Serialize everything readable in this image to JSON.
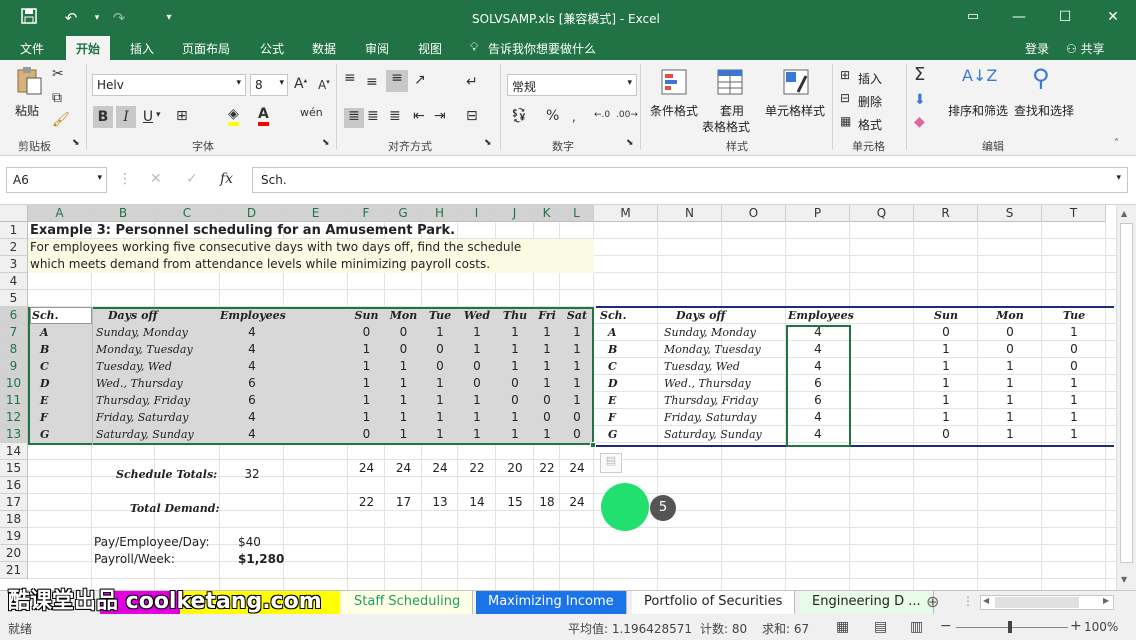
{
  "window": {
    "title": "SOLVSAMP.xls  [兼容模式] - Excel",
    "login_label": "登录",
    "share_label": "共享"
  },
  "menu": {
    "items": [
      "文件",
      "开始",
      "插入",
      "页面布局",
      "公式",
      "数据",
      "审阅",
      "视图"
    ],
    "tell_me": "告诉我你想要做什么"
  },
  "ribbon": {
    "paste_label": "粘贴",
    "font_name": "Helv",
    "font_size": "8",
    "number_format": "常规",
    "bold": "B",
    "italic": "I",
    "underline": "U",
    "conditional_format": "条件格式",
    "table_format_1": "套用",
    "table_format_2": "表格格式",
    "cell_style": "单元格样式",
    "insert": "插入",
    "delete": "删除",
    "format": "格式",
    "sort_filter": "排序和筛选",
    "find_select": "查找和选择",
    "groups": {
      "clipboard": "剪贴板",
      "font": "字体",
      "alignment": "对齐方式",
      "number": "数字",
      "styles": "样式",
      "cells": "单元格",
      "editing": "编辑"
    }
  },
  "formula_bar": {
    "name_box": "A6",
    "fx": "fx",
    "content": "Sch."
  },
  "sheet": {
    "columns": [
      "A",
      "B",
      "C",
      "D",
      "E",
      "F",
      "G",
      "H",
      "I",
      "J",
      "K",
      "L",
      "M",
      "N",
      "O",
      "P",
      "Q",
      "R",
      "S",
      "T"
    ],
    "rows": [
      "1",
      "2",
      "3",
      "4",
      "5",
      "6",
      "7",
      "8",
      "9",
      "10",
      "11",
      "12",
      "13",
      "14",
      "15",
      "16",
      "17",
      "18",
      "19",
      "20",
      "21"
    ],
    "title": "Example 3:  Personnel scheduling for an Amusement Park.",
    "desc1": "For employees working five consecutive days with two days off, find the schedule",
    "desc2": "which meets demand from attendance levels while minimizing payroll costs.",
    "left_headers": {
      "sch": "Sch.",
      "days_off": "Days off",
      "employees": "Employees",
      "days": [
        "Sun",
        "Mon",
        "Tue",
        "Wed",
        "Thu",
        "Fri",
        "Sat"
      ]
    },
    "right_headers": {
      "sch": "Sch.",
      "days_off": "Days off",
      "employees": "Employees",
      "days": [
        "Sun",
        "Mon",
        "Tue"
      ]
    },
    "schedule": [
      {
        "sch": "A",
        "off": "Sunday, Monday",
        "emp": "4",
        "d": [
          "0",
          "0",
          "1",
          "1",
          "1",
          "1",
          "1"
        ]
      },
      {
        "sch": "B",
        "off": "Monday, Tuesday",
        "emp": "4",
        "d": [
          "1",
          "0",
          "0",
          "1",
          "1",
          "1",
          "1"
        ]
      },
      {
        "sch": "C",
        "off": "Tuesday, Wed",
        "emp": "4",
        "d": [
          "1",
          "1",
          "0",
          "0",
          "1",
          "1",
          "1"
        ]
      },
      {
        "sch": "D",
        "off": "Wed., Thursday",
        "emp": "6",
        "d": [
          "1",
          "1",
          "1",
          "0",
          "0",
          "1",
          "1"
        ]
      },
      {
        "sch": "E",
        "off": "Thursday, Friday",
        "emp": "6",
        "d": [
          "1",
          "1",
          "1",
          "1",
          "0",
          "0",
          "1"
        ]
      },
      {
        "sch": "F",
        "off": "Friday, Saturday",
        "emp": "4",
        "d": [
          "1",
          "1",
          "1",
          "1",
          "1",
          "0",
          "0"
        ]
      },
      {
        "sch": "G",
        "off": "Saturday, Sunday",
        "emp": "4",
        "d": [
          "0",
          "1",
          "1",
          "1",
          "1",
          "1",
          "0"
        ]
      }
    ],
    "schedule_totals_label": "Schedule Totals:",
    "schedule_total": "32",
    "totals": [
      "24",
      "24",
      "24",
      "22",
      "20",
      "22",
      "24"
    ],
    "total_demand_label": "Total Demand:",
    "demand": [
      "22",
      "17",
      "13",
      "14",
      "15",
      "18",
      "24"
    ],
    "pay_label": "Pay/Employee/Day:",
    "pay_value": "$40",
    "payroll_label": "Payroll/Week:",
    "payroll_value": "$1,280",
    "step_badge": "5"
  },
  "tabs": {
    "items": [
      "Staff Scheduling",
      "Maximizing Income",
      "Portfolio of Securities",
      "Engineering D ..."
    ],
    "watermark": "酷课堂出品 coolketang.com"
  },
  "status": {
    "ready": "就绪",
    "average": "平均值: 1.196428571",
    "count": "计数: 80",
    "sum": "求和: 67",
    "zoom": "100%"
  },
  "colors": {
    "excel_green": "#217346",
    "tab_active_blue": "#1a73e8",
    "badge_green": "#22e070"
  }
}
